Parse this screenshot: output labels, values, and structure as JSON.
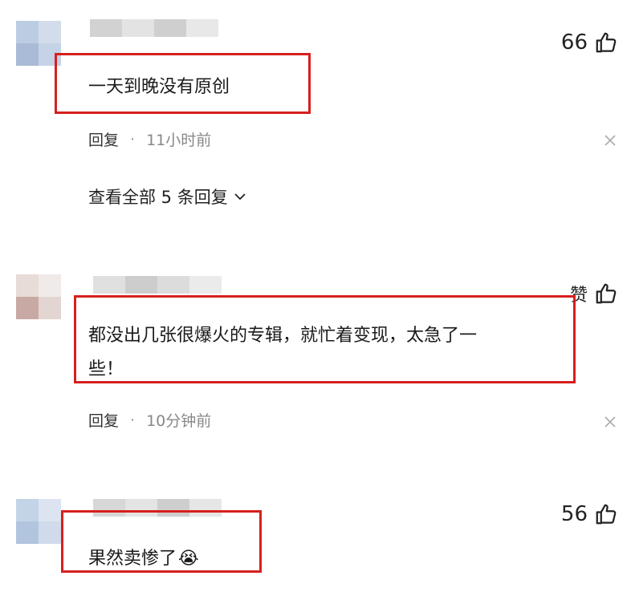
{
  "comments": [
    {
      "likes": "66",
      "text": "一天到晚没有原创",
      "reply_label": "回复",
      "separator": "·",
      "time": "11小时前",
      "replies_label": "查看全部 5 条回复"
    },
    {
      "likes": "赞",
      "text_line1": "都没出几张很爆火的专辑，就忙着变现，太急了一",
      "text_line2": "些！",
      "reply_label": "回复",
      "separator": "·",
      "time": "10分钟前"
    },
    {
      "likes": "56",
      "text": "果然卖惨了",
      "emoji": "😭"
    }
  ],
  "icons": {
    "like": "thumbs-up-icon",
    "close": "close-icon",
    "expand": "chevron-down-icon"
  },
  "colors": {
    "highlight": "#d6201f",
    "meta_gray": "#888888"
  }
}
